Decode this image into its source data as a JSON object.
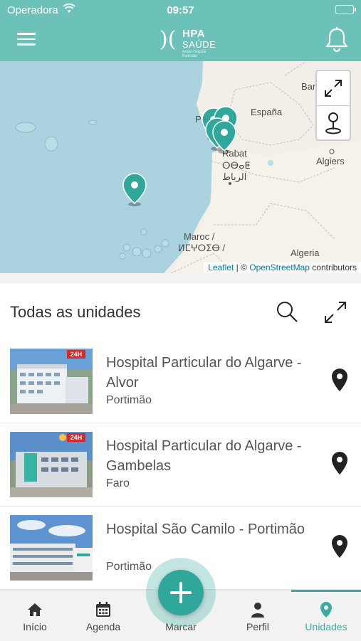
{
  "status_bar": {
    "carrier": "Operadora",
    "time": "09:57"
  },
  "header": {
    "logo_line1": "HPA",
    "logo_line2": "SAÚDE",
    "logo_sub": "Grupo Hospital Particular"
  },
  "map": {
    "labels": {
      "spain": "España",
      "rabat_latin": "Rabat",
      "rabat_tifinagh": "ⵔⴱⴰⵟ",
      "rabat_arabic": "الرباط",
      "algiers": "Algiers",
      "morocco_latin": "Maroc /",
      "morocco_tifinagh": "ⵍⵎⵖⵔⵉⴱ /",
      "algeria": "Algeria",
      "barcelona_partial": "Bar",
      "portugal_partial": "P"
    },
    "attribution": {
      "leaflet": "Leaflet",
      "separator": " | © ",
      "osm": "OpenStreetMap",
      "suffix": " contributors"
    },
    "colors": {
      "water": "#aad3df",
      "land": "#f2efe9",
      "marker": "#2fa89b"
    }
  },
  "list": {
    "title": "Todas as unidades",
    "units": [
      {
        "name": "Hospital Particular do Algarve - Alvor",
        "city": "Portimão",
        "badge": "24H"
      },
      {
        "name": "Hospital Particular do Algarve - Gambelas",
        "city": "Faro",
        "badge": "24H"
      },
      {
        "name": "Hospital São Camilo - Portimão",
        "city": "Portimão"
      }
    ]
  },
  "tabs": [
    {
      "label": "Início",
      "icon": "home-icon"
    },
    {
      "label": "Agenda",
      "icon": "calendar-icon"
    },
    {
      "label": "Marcar",
      "icon": "plus-icon"
    },
    {
      "label": "Perfil",
      "icon": "person-icon"
    },
    {
      "label": "Unidades",
      "icon": "location-pin-icon",
      "active": true
    }
  ],
  "accent_color": "#6cc2b8"
}
